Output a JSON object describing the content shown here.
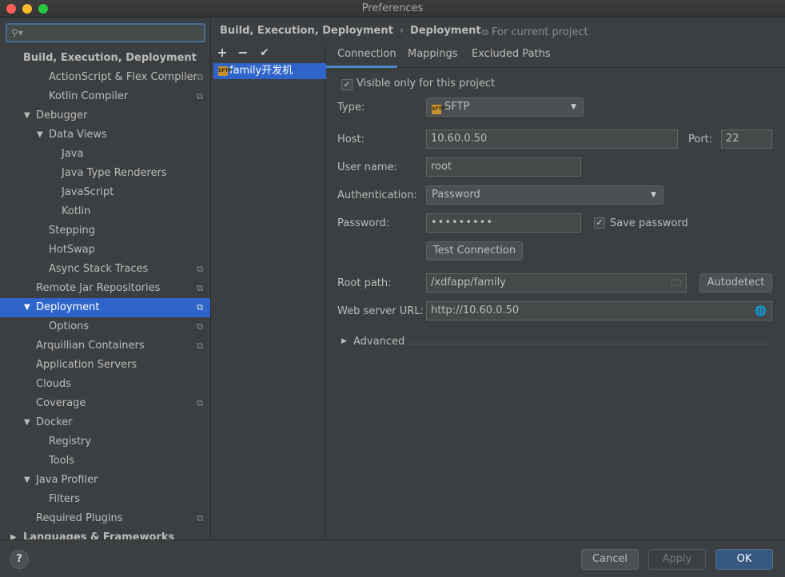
{
  "window": {
    "title": "Preferences"
  },
  "sidebar": {
    "search_placeholder": "",
    "items": [
      {
        "label": "Build, Execution, Deployment"
      },
      {
        "label": "ActionScript & Flex Compiler"
      },
      {
        "label": "Kotlin Compiler"
      },
      {
        "label": "Debugger"
      },
      {
        "label": "Data Views"
      },
      {
        "label": "Java"
      },
      {
        "label": "Java Type Renderers"
      },
      {
        "label": "JavaScript"
      },
      {
        "label": "Kotlin"
      },
      {
        "label": "Stepping"
      },
      {
        "label": "HotSwap"
      },
      {
        "label": "Async Stack Traces"
      },
      {
        "label": "Remote Jar Repositories"
      },
      {
        "label": "Deployment"
      },
      {
        "label": "Options"
      },
      {
        "label": "Arquillian Containers"
      },
      {
        "label": "Application Servers"
      },
      {
        "label": "Clouds"
      },
      {
        "label": "Coverage"
      },
      {
        "label": "Docker"
      },
      {
        "label": "Registry"
      },
      {
        "label": "Tools"
      },
      {
        "label": "Java Profiler"
      },
      {
        "label": "Filters"
      },
      {
        "label": "Required Plugins"
      },
      {
        "label": "Languages & Frameworks"
      }
    ]
  },
  "breadcrumb": {
    "parent": "Build, Execution, Deployment",
    "sep": "›",
    "current": "Deployment"
  },
  "scope": {
    "label": "For current project"
  },
  "servers": {
    "add": "+",
    "remove": "−",
    "apply": "✔",
    "items": [
      {
        "label": "family开发机",
        "icon_text": "SFTP"
      }
    ]
  },
  "tabs": [
    {
      "label": "Connection"
    },
    {
      "label": "Mappings"
    },
    {
      "label": "Excluded Paths"
    }
  ],
  "form": {
    "visible_only": {
      "label": "Visible only for this project",
      "checked": true
    },
    "type": {
      "label": "Type:",
      "value": "SFTP"
    },
    "host": {
      "label": "Host:",
      "value": "10.60.0.50"
    },
    "port": {
      "label": "Port:",
      "value": "22"
    },
    "user": {
      "label": "User name:",
      "value": "root"
    },
    "auth": {
      "label": "Authentication:",
      "value": "Password"
    },
    "password": {
      "label": "Password:",
      "value": "•••••••••"
    },
    "save_password": {
      "label": "Save password",
      "checked": true
    },
    "test_button": "Test Connection",
    "root_path": {
      "label": "Root path:",
      "value": "/xdfapp/family"
    },
    "autodetect": "Autodetect",
    "web_url": {
      "label": "Web server URL:",
      "value": "http://10.60.0.50"
    },
    "advanced": "Advanced"
  },
  "footer": {
    "help": "?",
    "cancel": "Cancel",
    "apply": "Apply",
    "ok": "OK"
  }
}
